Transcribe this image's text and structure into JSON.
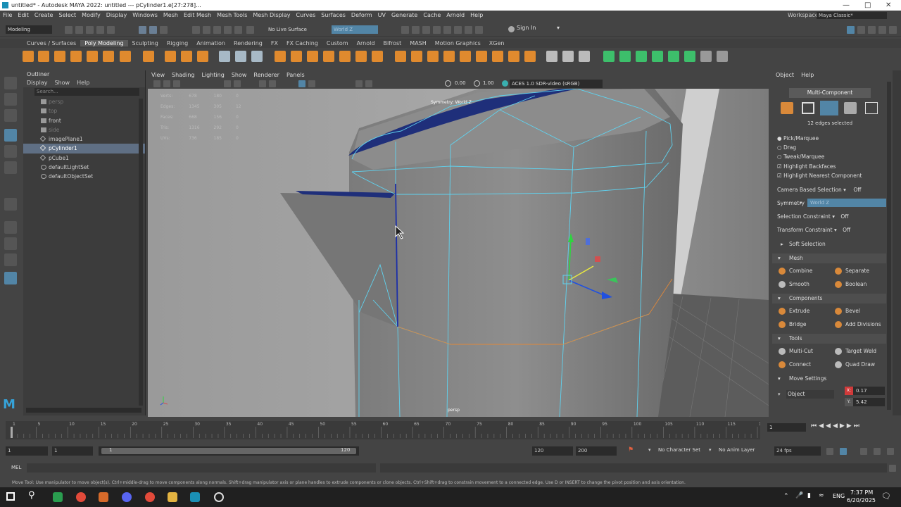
{
  "window": {
    "title": "untitled* - Autodesk MAYA 2022: untitled   ---   pCylinder1.e[27:278]..."
  },
  "menubar": {
    "items": [
      "File",
      "Edit",
      "Create",
      "Select",
      "Modify",
      "Display",
      "Windows",
      "Mesh",
      "Edit Mesh",
      "Mesh Tools",
      "Mesh Display",
      "Curves",
      "Surfaces",
      "Deform",
      "UV",
      "Generate",
      "Cache",
      "Arnold",
      "Help"
    ],
    "workspace_label": "Workspace :",
    "workspace_value": "Maya Classic*"
  },
  "statusline": {
    "mode": "Modeling",
    "live_surface": "No Live Surface",
    "space": "World Z",
    "sign_in": "Sign In"
  },
  "shelf": {
    "tabs": [
      "Curves / Surfaces",
      "Poly Modeling",
      "Sculpting",
      "Rigging",
      "Animation",
      "Rendering",
      "FX",
      "FX Caching",
      "Custom",
      "Arnold",
      "Bifrost",
      "MASH",
      "Motion Graphics",
      "XGen"
    ],
    "active_tab": "Poly Modeling"
  },
  "outliner": {
    "title": "Outliner",
    "menu": [
      "Display",
      "Show",
      "Help"
    ],
    "search_placeholder": "Search...",
    "items": [
      {
        "label": "persp",
        "state": "dim"
      },
      {
        "label": "top",
        "state": "dim"
      },
      {
        "label": "front",
        "state": "normal"
      },
      {
        "label": "side",
        "state": "dim"
      },
      {
        "label": "imagePlane1",
        "state": "normal"
      },
      {
        "label": "pCylinder1",
        "state": "selected"
      },
      {
        "label": "pCube1",
        "state": "normal"
      },
      {
        "label": "defaultLightSet",
        "state": "normal"
      },
      {
        "label": "defaultObjectSet",
        "state": "normal"
      }
    ]
  },
  "viewport": {
    "menu": [
      "View",
      "Shading",
      "Lighting",
      "Show",
      "Renderer",
      "Panels"
    ],
    "exposure": "0.00",
    "gamma": "1.00",
    "color_space": "ACES 1.0 SDR-video (sRGB)",
    "symmetry_label": "Symmetry: World Z",
    "camera_label": "persp",
    "hud": [
      {
        "label": "Verts:",
        "a": "678",
        "b": "180",
        "c": "0"
      },
      {
        "label": "Edges:",
        "a": "1345",
        "b": "305",
        "c": "12"
      },
      {
        "label": "Faces:",
        "a": "668",
        "b": "156",
        "c": "0"
      },
      {
        "label": "Tris:",
        "a": "1316",
        "b": "292",
        "c": "0"
      },
      {
        "label": "UVs:",
        "a": "736",
        "b": "185",
        "c": "0"
      }
    ]
  },
  "attr": {
    "tabs": [
      "Object",
      "Help"
    ],
    "header": "Multi-Component",
    "edges_selected": "12 edges selected",
    "pick_options": [
      "Pick/Marquee",
      "Drag",
      "Tweak/Marquee"
    ],
    "checks": [
      "Highlight Backfaces",
      "Highlight Nearest Component"
    ],
    "camera_based": {
      "label": "Camera Based Selection",
      "value": "Off"
    },
    "symmetry": {
      "label": "Symmetry",
      "value": "World Z"
    },
    "selection_constraint": {
      "label": "Selection Constraint",
      "value": "Off"
    },
    "transform_constraint": {
      "label": "Transform Constraint",
      "value": "Off"
    },
    "sections": {
      "soft": "Soft Selection",
      "mesh": "Mesh",
      "components": "Components",
      "tools": "Tools",
      "move": "Move Settings"
    },
    "mesh_buttons": [
      "Combine",
      "Separate",
      "Smooth",
      "Boolean"
    ],
    "component_buttons": [
      "Extrude",
      "Bevel",
      "Bridge",
      "Add Divisions"
    ],
    "tool_buttons": [
      "Multi-Cut",
      "Target Weld",
      "Connect",
      "Quad Draw"
    ],
    "move_object": "Object",
    "move_x": "0.17",
    "move_y": "5.42",
    "x_label": "X:",
    "y_label": "Y:"
  },
  "timeline": {
    "ticks": [
      "1",
      "5",
      "10",
      "15",
      "20",
      "25",
      "30",
      "35",
      "40",
      "45",
      "50",
      "55",
      "60",
      "65",
      "70",
      "75",
      "80",
      "85",
      "90",
      "95",
      "100",
      "105",
      "110",
      "115",
      "120"
    ],
    "current_frame": "1"
  },
  "range": {
    "start": "1",
    "inner_start": "1",
    "slider_start": "1",
    "slider_end": "120",
    "end": "120",
    "max": "200",
    "character_set": "No Character Set",
    "anim_layer": "No Anim Layer",
    "fps": "24 fps"
  },
  "cmd": {
    "lang": "MEL"
  },
  "help_line": "Move Tool: Use manipulator to move object(s). Ctrl+middle-drag to move components along normals. Shift+drag manipulator axis or plane handles to extrude components or clone objects. Ctrl+Shift+drag to constrain movement to a connected edge. Use D or INSERT to change the pivot position and axis orientation.",
  "taskbar": {
    "lang": "ENG",
    "time": "7:37 PM",
    "date": "6/20/2025"
  },
  "colors": {
    "accent": "#5285a6",
    "selection_blue": "#1c2fa8",
    "wire": "#5fd3f0",
    "orange_edge": "#e0883a"
  }
}
